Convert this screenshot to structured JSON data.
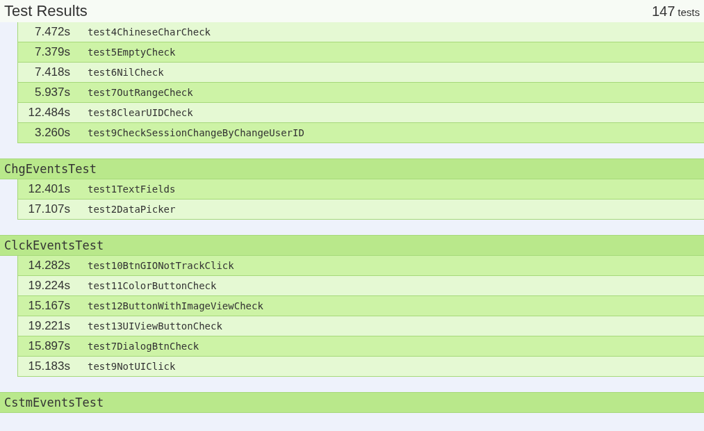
{
  "header": {
    "title": "Test Results",
    "count": "147",
    "unit": "tests"
  },
  "groups": [
    {
      "tests": [
        {
          "time": "7.472s",
          "name": "test4ChineseCharCheck",
          "striped": false
        },
        {
          "time": "7.379s",
          "name": "test5EmptyCheck",
          "striped": true
        },
        {
          "time": "7.418s",
          "name": "test6NilCheck",
          "striped": false
        },
        {
          "time": "5.937s",
          "name": "test7OutRangeCheck",
          "striped": true
        },
        {
          "time": "12.484s",
          "name": "test8ClearUIDCheck",
          "striped": false
        },
        {
          "time": "3.260s",
          "name": "test9CheckSessionChangeByChangeUserID",
          "striped": true
        }
      ]
    },
    {
      "name": "ChgEventsTest",
      "tests": [
        {
          "time": "12.401s",
          "name": "test1TextFields",
          "striped": true
        },
        {
          "time": "17.107s",
          "name": "test2DataPicker",
          "striped": false
        }
      ]
    },
    {
      "name": "ClckEventsTest",
      "tests": [
        {
          "time": "14.282s",
          "name": "test10BtnGIONotTrackClick",
          "striped": true
        },
        {
          "time": "19.224s",
          "name": "test11ColorButtonCheck",
          "striped": false
        },
        {
          "time": "15.167s",
          "name": "test12ButtonWithImageViewCheck",
          "striped": true
        },
        {
          "time": "19.221s",
          "name": "test13UIViewButtonCheck",
          "striped": false
        },
        {
          "time": "15.897s",
          "name": "test7DialogBtnCheck",
          "striped": true
        },
        {
          "time": "15.183s",
          "name": "test9NotUIClick",
          "striped": false
        }
      ]
    },
    {
      "name": "CstmEventsTest"
    }
  ]
}
